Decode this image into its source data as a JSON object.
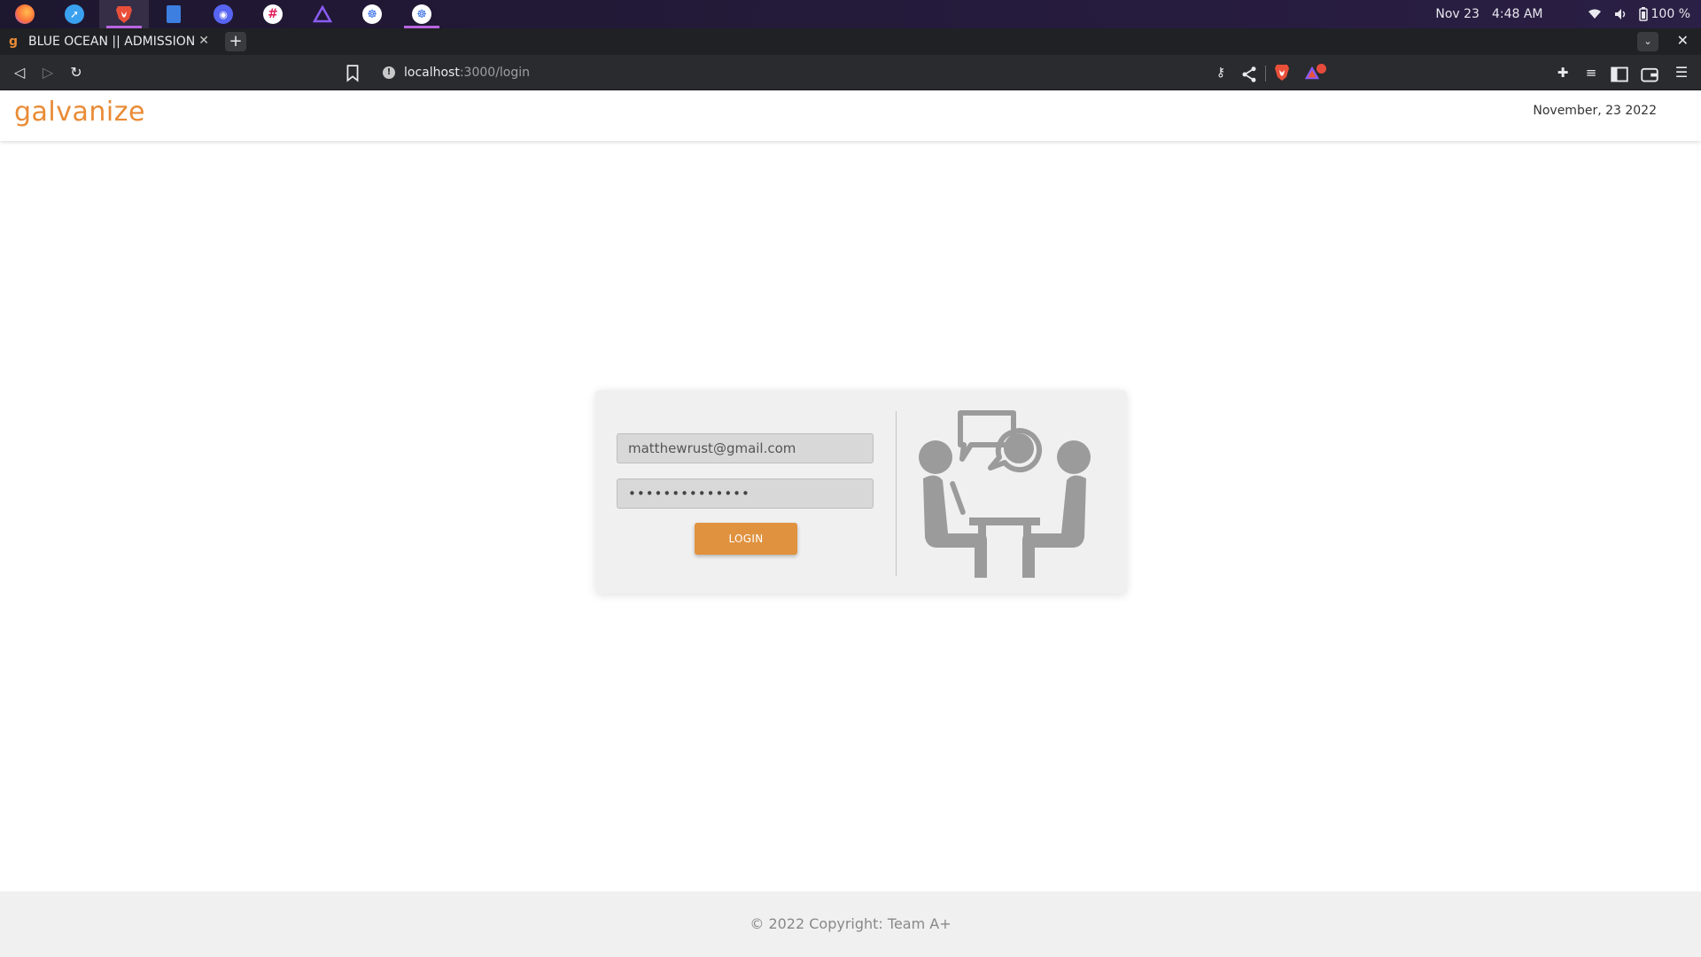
{
  "os": {
    "clock_date": "Nov 23",
    "clock_time": "4:48 AM",
    "battery": "100 %",
    "apps": [
      {
        "name": "firefox-icon",
        "color": "#ff7139"
      },
      {
        "name": "compass-icon",
        "color": "#3aa0f0"
      },
      {
        "name": "brave-icon",
        "color": "#e9503a"
      },
      {
        "name": "document-icon",
        "color": "#3d7fe0"
      },
      {
        "name": "discord-icon",
        "color": "#5865f2"
      },
      {
        "name": "slack-icon",
        "color": "#ffffff"
      },
      {
        "name": "triangle-app-icon",
        "color": "#8a5cf5"
      },
      {
        "name": "kubernetes-icon",
        "color": "#ffffff"
      },
      {
        "name": "kubernetes-active-icon",
        "color": "#ffffff"
      }
    ]
  },
  "browser": {
    "tab_title": "BLUE OCEAN || ADMISSION",
    "url_host": "localhost",
    "url_path": ":3000/login"
  },
  "header": {
    "logo": "galvanize",
    "date": "November, 23 2022"
  },
  "login": {
    "email_value": "matthewrust@gmail.com",
    "password_value": "••••••••••••••",
    "button_label": "LOGIN"
  },
  "footer": {
    "copyright": "© 2022 Copyright: Team A+"
  },
  "colors": {
    "accent": "#e0923f",
    "logo": "#e98b36"
  }
}
